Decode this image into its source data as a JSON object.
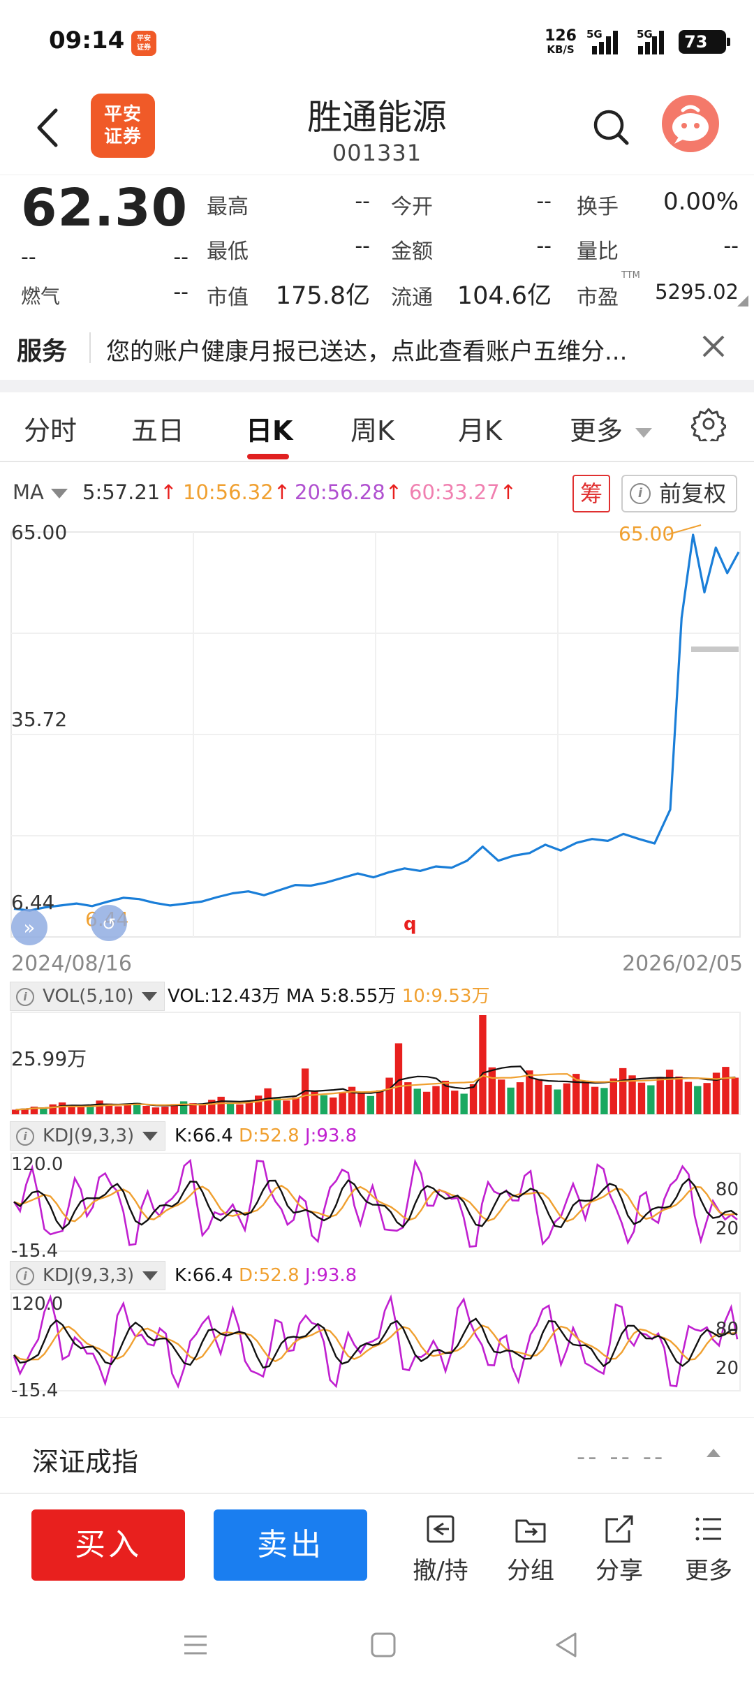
{
  "status_bar": {
    "time": "09:14",
    "notif_app": "平安\n证券",
    "net_speed_value": "126",
    "net_speed_unit": "KB/S",
    "sim1_label": "5G",
    "sim2_label": "5G",
    "battery": "73"
  },
  "header": {
    "app_logo_text": "平安\n证券",
    "stock_name": "胜通能源",
    "stock_code": "001331"
  },
  "quote": {
    "price": "62.30",
    "change": "--",
    "change_pct": "--",
    "mood_label": "燃气",
    "mood_value": "--",
    "grid": [
      {
        "label": "最高",
        "value": "--"
      },
      {
        "label": "今开",
        "value": "--"
      },
      {
        "label": "换手",
        "value": "0.00%"
      },
      {
        "label": "最低",
        "value": "--"
      },
      {
        "label": "金额",
        "value": "--"
      },
      {
        "label": "量比",
        "value": "--"
      },
      {
        "label": "市值",
        "value": "175.8亿"
      },
      {
        "label": "流通",
        "value": "104.6亿"
      },
      {
        "label": "市盈",
        "value": "5295.02"
      }
    ],
    "ttm_label": "TTM"
  },
  "service": {
    "tag": "服务",
    "text": "您的账户健康月报已送达，点此查看账户五维分..."
  },
  "tabs": {
    "items": [
      "分时",
      "五日",
      "日K",
      "周K",
      "月K",
      "更多"
    ],
    "active": "日K"
  },
  "ma_legend": {
    "selector": "MA",
    "items": [
      {
        "text": "5:57.21",
        "color": "#333333"
      },
      {
        "text": "10:56.32",
        "color": "#f0a030"
      },
      {
        "text": "20:56.28",
        "color": "#b050d0"
      },
      {
        "text": "60:33.27",
        "color": "#f080b0"
      }
    ],
    "arrow": "↑",
    "chou_label": "筹",
    "fuquan_label": "前复权"
  },
  "chart_data": {
    "type": "line",
    "series": [
      {
        "values": [
          6.5,
          6.2,
          6.7,
          7.0,
          7.3,
          6.9,
          7.6,
          8.2,
          8.0,
          7.4,
          7.0,
          7.3,
          7.6,
          8.3,
          8.9,
          9.2,
          8.6,
          9.4,
          10.2,
          10.1,
          10.6,
          11.3,
          12.0,
          11.4,
          12.2,
          12.8,
          12.4,
          13.1,
          12.9,
          14.0,
          16.2,
          14.0,
          14.8,
          15.2,
          16.5,
          15.6,
          16.8,
          17.4,
          17.1,
          18.2,
          17.4,
          16.7,
          22.0,
          52.0,
          65.0,
          56.0,
          63.0,
          59.0,
          62.3
        ]
      }
    ],
    "x_start_label": "2024/08/16",
    "x_end_label": "2026/02/05",
    "y_max_label": "65.00",
    "y_mid_label": "35.72",
    "y_min_label": "6.44",
    "ylim": [
      6.44,
      65.0
    ],
    "high_marker_label": "65.00",
    "low_marker_label": "6.44",
    "event_marker": "q",
    "grid": true
  },
  "vol_panel": {
    "title": "VOL(5,10)",
    "vol_text": "VOL:12.43万",
    "ma5_text": "MA 5:8.55万",
    "ma10_text": "10:9.53万",
    "axis_label": "25.99万",
    "values": [
      1.2,
      1.5,
      2.0,
      1.8,
      2.6,
      3.1,
      2.2,
      1.9,
      2.4,
      3.6,
      2.8,
      2.1,
      2.5,
      3.0,
      2.2,
      1.8,
      2.0,
      2.7,
      3.4,
      2.9,
      2.5,
      3.8,
      4.6,
      3.1,
      2.6,
      3.3,
      4.9,
      6.8,
      4.2,
      3.6,
      4.4,
      12.0,
      6.1,
      5.0,
      4.4,
      5.8,
      7.2,
      5.5,
      4.8,
      6.3,
      9.6,
      18.6,
      8.4,
      6.7,
      5.9,
      7.4,
      8.8,
      6.2,
      5.4,
      7.9,
      25.99,
      12.3,
      9.1,
      7.0,
      8.4,
      11.5,
      9.2,
      7.7,
      6.5,
      8.1,
      10.6,
      8.8,
      7.2,
      6.9,
      9.4,
      12.1,
      10.2,
      8.3,
      7.6,
      9.8,
      11.7,
      9.9,
      8.5,
      7.4,
      8.2,
      10.9,
      12.43,
      9.6
    ]
  },
  "kdj_panels": [
    {
      "title": "KDJ(9,3,3)",
      "k_text": "K:66.4",
      "d_text": "D:52.8",
      "j_text": "J:93.8",
      "axis_top": "120.0",
      "axis_bottom": "-15.4",
      "ref_high": "80",
      "ref_low": "20"
    },
    {
      "title": "KDJ(9,3,3)",
      "k_text": "K:66.4",
      "d_text": "D:52.8",
      "j_text": "J:93.8",
      "axis_top": "120.0",
      "axis_bottom": "-15.4",
      "ref_high": "80",
      "ref_low": "20"
    }
  ],
  "index_bar": {
    "name": "深证成指",
    "values": "-- -- --"
  },
  "actions": {
    "buy": "买入",
    "sell": "卖出",
    "items": [
      "撤/持",
      "分组",
      "分享",
      "更多"
    ]
  },
  "colors": {
    "price_line": "#1a7ed8",
    "up_red": "#e8201e",
    "down_green": "#1aa860",
    "ma10_orange": "#f0a030",
    "ma20_purple": "#b050d0",
    "kdj_j": "#c020d0",
    "accent_orange": "#f05a28"
  }
}
